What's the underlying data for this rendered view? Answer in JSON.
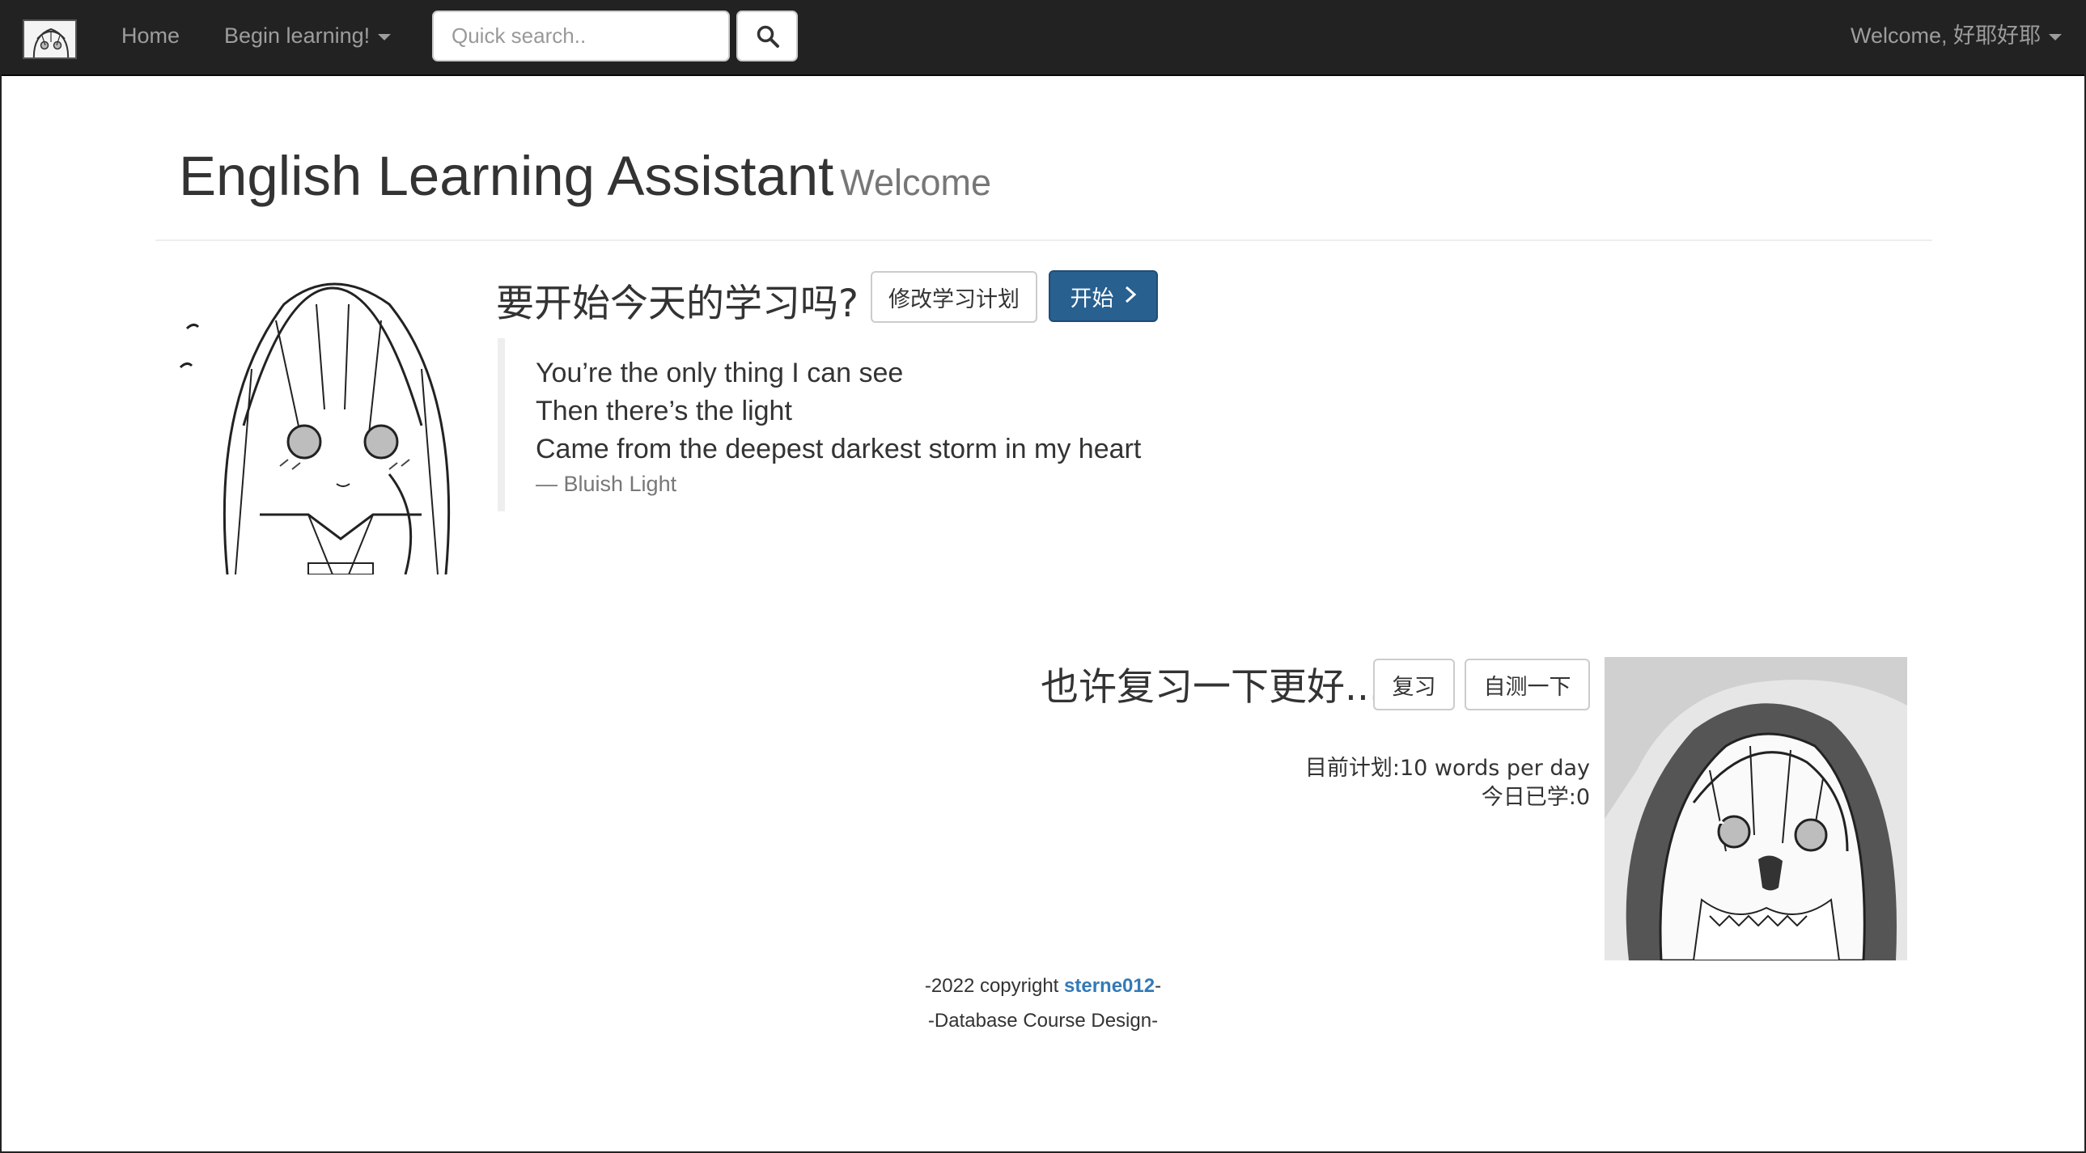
{
  "navbar": {
    "logo_icon": "anime-girl-logo-icon",
    "home_label": "Home",
    "learn_menu_label": "Begin learning!",
    "search_placeholder": "Quick search..",
    "search_icon": "search-icon",
    "welcome_label": "Welcome, 好耶好耶"
  },
  "header": {
    "title": "English Learning Assistant",
    "subtitle": "Welcome"
  },
  "start_section": {
    "heading": "要开始今天的学习吗?",
    "edit_plan_label": "修改学习计划",
    "start_label": "开始",
    "start_icon": "chevron-right-icon",
    "quote_lines": [
      "You’re the only thing I can see",
      "Then there’s the light",
      "Came from the deepest darkest storm in my heart"
    ],
    "quote_source": "— Bluish Light"
  },
  "review_section": {
    "heading": "也许复习一下更好...",
    "review_label": "复习",
    "self_test_label": "自测一下",
    "plan_text": "目前计划:10 words per day",
    "learned_today_text": "今日已学:0"
  },
  "footer": {
    "copyright_prefix": "-2022 copyright ",
    "author": "sterne012",
    "copyright_suffix": "-",
    "course_text": "-Database Course Design-"
  },
  "colors": {
    "navbar_bg": "#222222",
    "nav_text": "#9d9d9d",
    "primary_button": "#286090",
    "link": "#337ab7"
  }
}
